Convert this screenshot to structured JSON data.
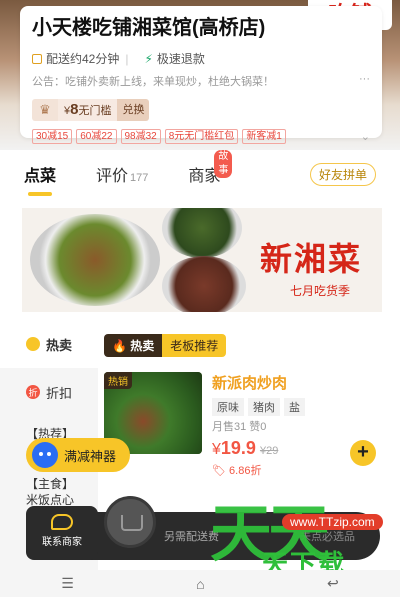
{
  "header": {
    "brand_sign": "吃铺",
    "shop_name": "小天楼吃铺湘菜馆(高桥店)",
    "delivery_time": "配送约42分钟",
    "refund": "极速退款",
    "notice": "公告：吃铺外卖新上线，来单现炒，杜绝大锅菜！",
    "notice_more": "···",
    "coupon": {
      "symbol": "¥",
      "amount": "8",
      "condition": "无门槛",
      "action": "兑换"
    },
    "promos": [
      "30减15",
      "60减22",
      "98减32",
      "8元无门槛红包",
      "新客减1"
    ]
  },
  "tabs": [
    {
      "label": "点菜",
      "count": ""
    },
    {
      "label": "评价",
      "count": "177"
    },
    {
      "label": "商家",
      "badge": "故事"
    }
  ],
  "share_button": "好友拼单",
  "banner": {
    "title": "新湘菜",
    "subtitle": "七月吃货季"
  },
  "sidebar": {
    "items": [
      {
        "label": "热卖"
      },
      {
        "label": "折扣"
      }
    ],
    "group1": "【热荐】",
    "group2": "【主食】",
    "group2_sub": "米饭点心"
  },
  "section": {
    "hot": "热卖",
    "title": "老板推荐"
  },
  "dish": {
    "badge": "热销",
    "name": "新派肉炒肉",
    "tags": [
      "原味",
      "猪肉",
      "盐"
    ],
    "sales": "月售31  赞0",
    "price_symbol": "¥",
    "price": "19.9",
    "orig_price": "¥29",
    "discount": "6.86折",
    "add": "+"
  },
  "fab": "满减神器",
  "cart": {
    "contact": "联系商家",
    "extra_fee": "另需配送费",
    "min_order": "未点必选品"
  },
  "nav": {
    "menu": "☰",
    "home": "⌂",
    "back": "↩"
  },
  "watermark": {
    "main": "天天",
    "url": "www.TTzip.com",
    "sub": "天下载"
  }
}
